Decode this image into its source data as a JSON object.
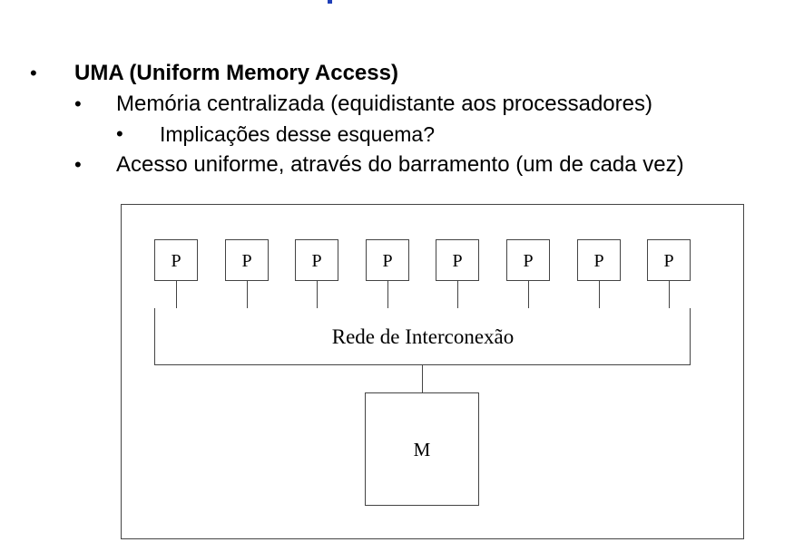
{
  "bullets": {
    "uma": "UMA (Uniform Memory Access)",
    "memoria": "Memória centralizada (equidistante aos processadores)",
    "implicacoes": "Implicações desse esquema?",
    "acesso": "Acesso uniforme, através do barramento (um de cada vez)",
    "marker": "•"
  },
  "diagram": {
    "processors": [
      "P",
      "P",
      "P",
      "P",
      "P",
      "P",
      "P",
      "P"
    ],
    "network_label": "Rede de Interconexão",
    "memory_label": "M"
  }
}
